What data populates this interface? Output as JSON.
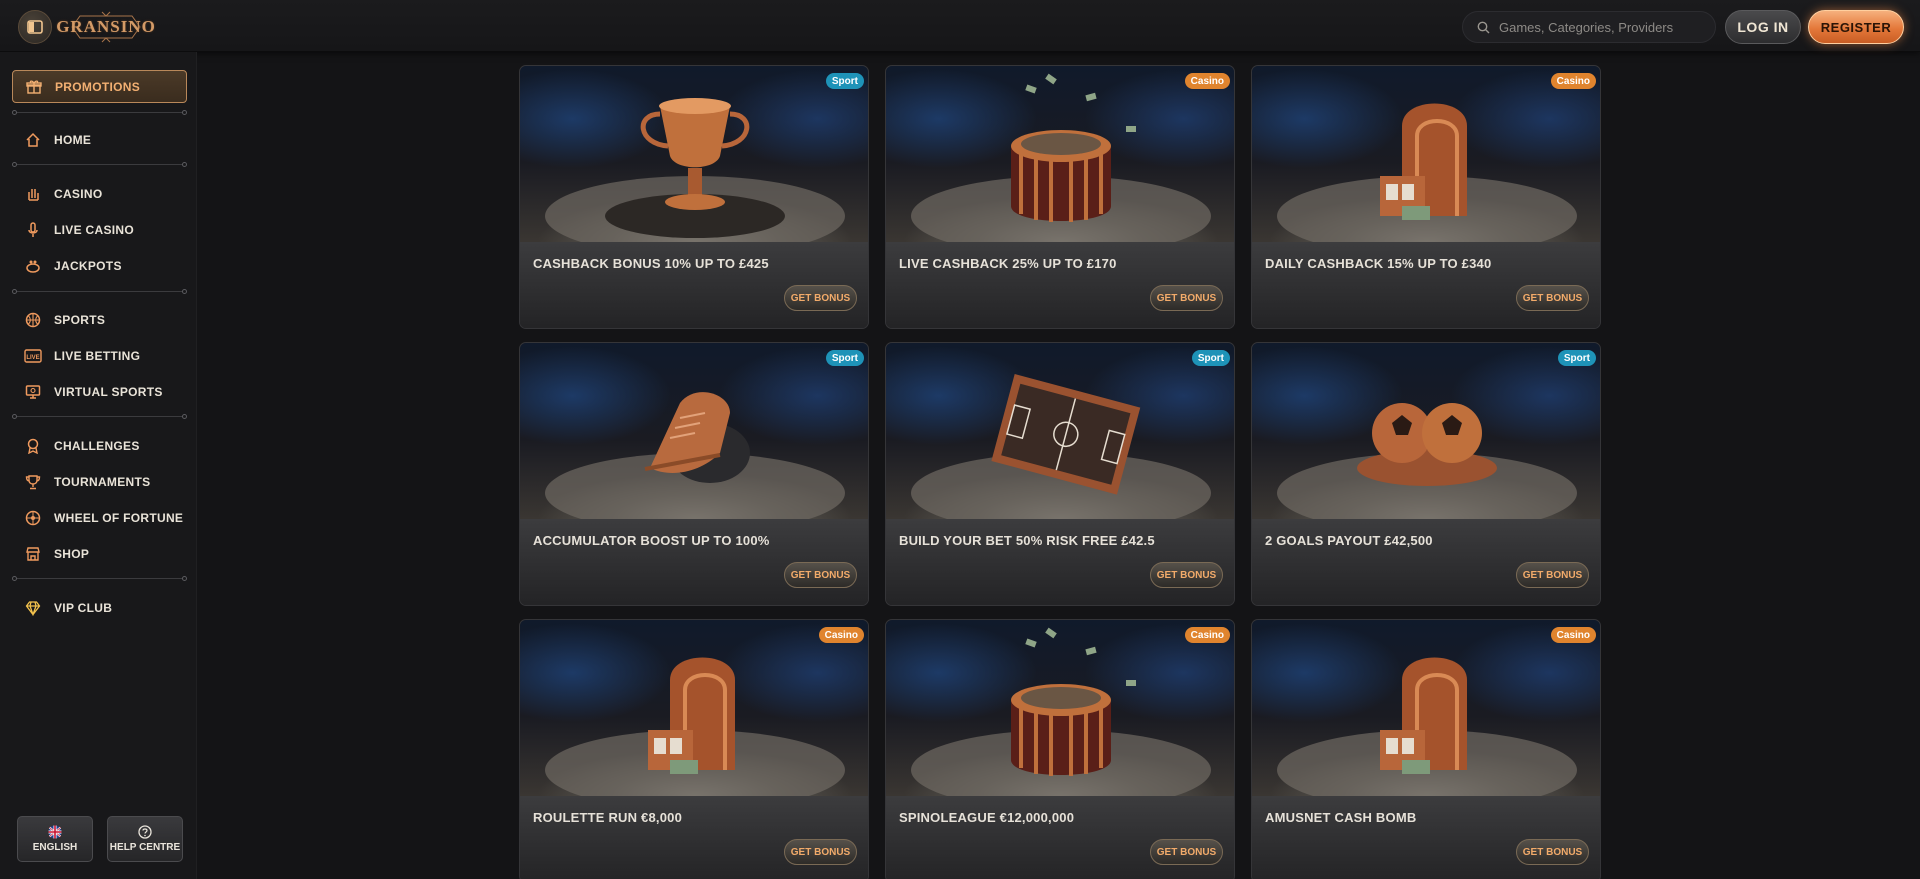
{
  "header": {
    "brand": "GRANSINO",
    "search_placeholder": "Games, Categories, Providers",
    "login_label": "LOG IN",
    "register_label": "REGISTER"
  },
  "sidebar": {
    "promotions": "PROMOTIONS",
    "home": "HOME",
    "casino": "CASINO",
    "live_casino": "LIVE CASINO",
    "jackpots": "JACKPOTS",
    "sports": "SPORTS",
    "live_betting": "LIVE BETTING",
    "virtual_sports": "VIRTUAL SPORTS",
    "challenges": "CHALLENGES",
    "tournaments": "TOURNAMENTS",
    "wheel_of_fortune": "WHEEL OF FORTUNE",
    "shop": "SHOP",
    "vip_club": "VIP CLUB",
    "language": "ENGLISH",
    "help": "HELP CENTRE"
  },
  "colors": {
    "accent": "#f3b072",
    "sport_badge": "#1e93b8",
    "casino_badge": "#e0842e"
  },
  "promotions": [
    {
      "title": "CASHBACK BONUS 10% UP TO £425",
      "badge": "Sport",
      "button": "GET BONUS",
      "image": "trophy-cup"
    },
    {
      "title": "LIVE CASHBACK 25% UP TO £170",
      "badge": "Casino",
      "button": "GET BONUS",
      "image": "roulette-wheel"
    },
    {
      "title": "DAILY CASHBACK 15% UP TO £340",
      "badge": "Casino",
      "button": "GET BONUS",
      "image": "slot-machine"
    },
    {
      "title": "ACCUMULATOR BOOST UP TO 100%",
      "badge": "Sport",
      "button": "GET BONUS",
      "image": "football-boot"
    },
    {
      "title": "BUILD YOUR BET 50% RISK FREE £42.5",
      "badge": "Sport",
      "button": "GET BONUS",
      "image": "tactics-board"
    },
    {
      "title": "2 GOALS PAYOUT £42,500",
      "badge": "Sport",
      "button": "GET BONUS",
      "image": "footballs"
    },
    {
      "title": "ROULETTE RUN €8,000",
      "badge": "Casino",
      "button": "GET BONUS",
      "image": "slot-machine"
    },
    {
      "title": "SPINOLEAGUE €12,000,000",
      "badge": "Casino",
      "button": "GET BONUS",
      "image": "roulette-wheel"
    },
    {
      "title": "AMUSNET CASH BOMB",
      "badge": "Casino",
      "button": "GET BONUS",
      "image": "slot-machine"
    }
  ]
}
